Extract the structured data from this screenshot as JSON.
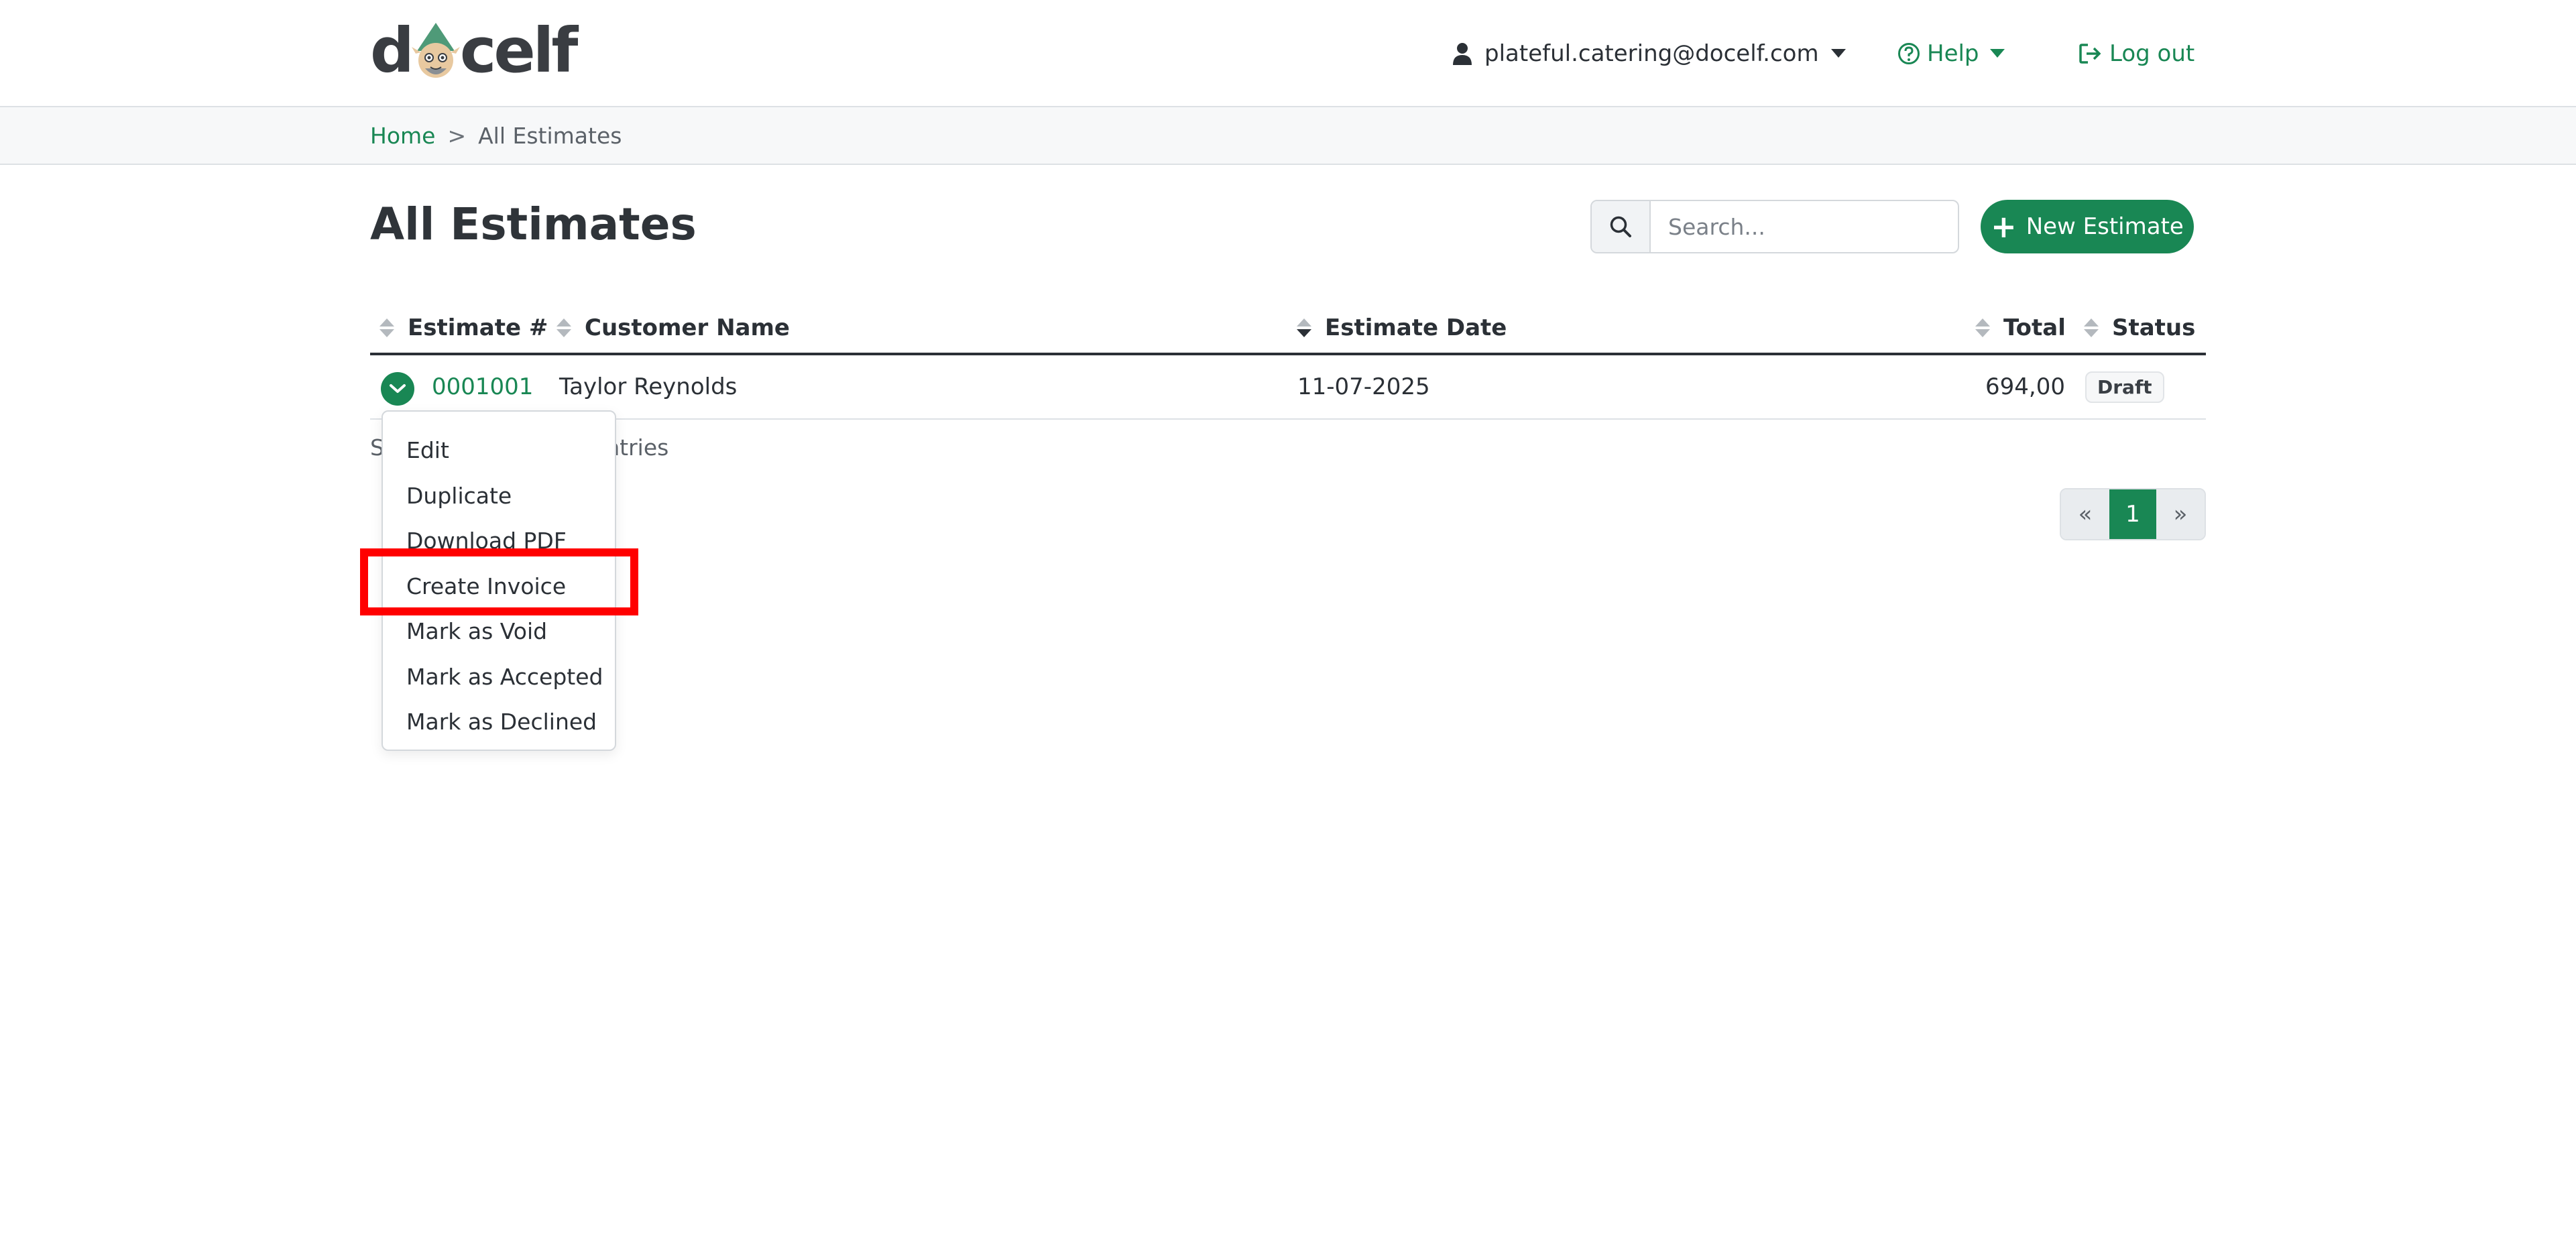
{
  "brand": {
    "logo_text_left": "d",
    "logo_text_right": "celf",
    "accent_color": "#198754"
  },
  "header": {
    "user_email": "plateful.catering@docelf.com",
    "help_label": "Help",
    "logout_label": "Log out"
  },
  "breadcrumb": {
    "home": "Home",
    "separator": ">",
    "current": "All Estimates"
  },
  "page": {
    "title": "All Estimates",
    "search_placeholder": "Search...",
    "new_button_label": "New Estimate"
  },
  "table": {
    "columns": [
      "Estimate #",
      "Customer Name",
      "Estimate Date",
      "Total",
      "Status"
    ],
    "sorted_column": "Estimate Date",
    "sort_direction": "descending",
    "rows": [
      {
        "number": "0001001",
        "customer": "Taylor Reynolds",
        "date": "11-07-2025",
        "total": "694,00",
        "status": "Draft"
      }
    ]
  },
  "footer": {
    "entries_text": "Showing 1 to 1 of 1 entries"
  },
  "pagination": {
    "prev": "«",
    "current": "1",
    "next": "»"
  },
  "row_menu": {
    "items": [
      "Edit",
      "Duplicate",
      "Download PDF",
      "Create Invoice",
      "Mark as Void",
      "Mark as Accepted",
      "Mark as Declined"
    ],
    "highlighted_item": "Create Invoice",
    "highlight_color": "#ff0000"
  },
  "icons": {
    "user": "user-icon",
    "help": "question-circle-icon",
    "logout": "sign-out-icon",
    "search": "search-icon",
    "plus": "plus-icon",
    "row_toggle": "chevron-down-icon"
  }
}
